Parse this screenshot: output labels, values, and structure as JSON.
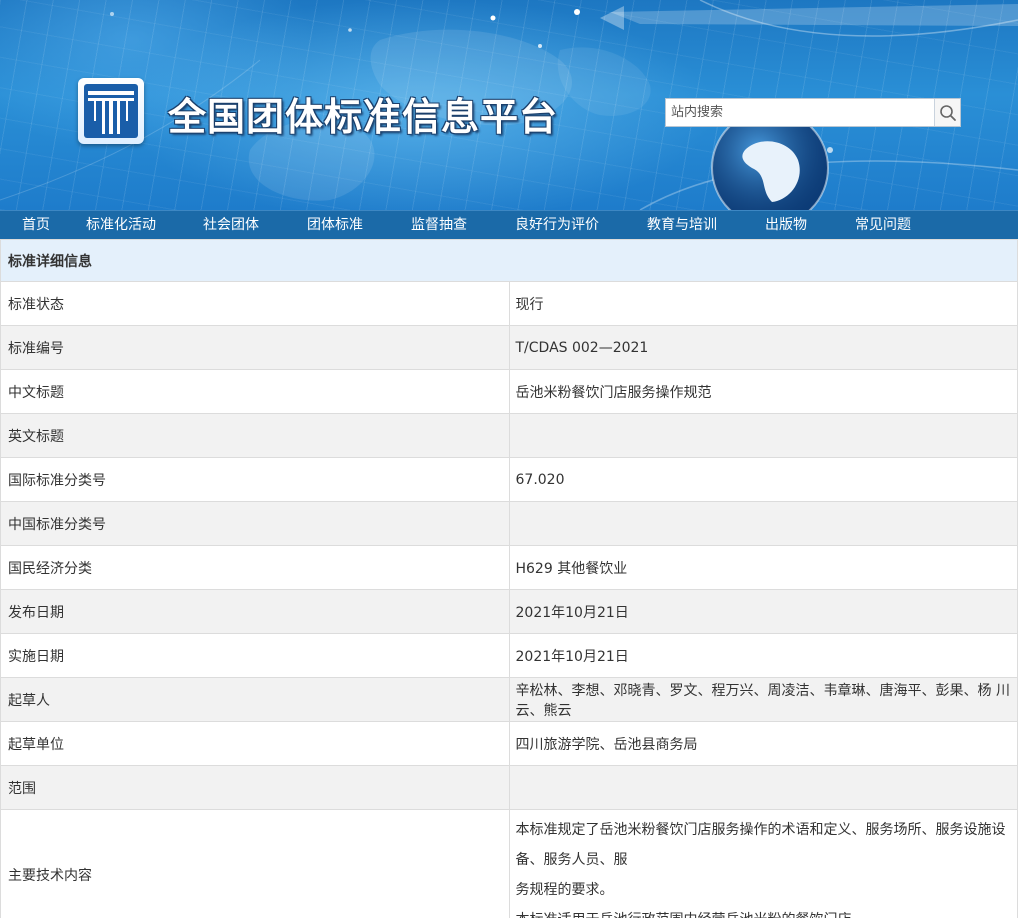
{
  "header": {
    "site_title": "全国团体标准信息平台",
    "search_placeholder": "站内搜索",
    "search_icon": "search-icon",
    "logo_icon": "standards-logo-icon"
  },
  "nav": {
    "items": [
      "首页",
      "标准化活动",
      "社会团体",
      "团体标准",
      "监督抽查",
      "良好行为评价",
      "教育与培训",
      "出版物",
      "常见问题"
    ]
  },
  "detail": {
    "heading": "标准详细信息",
    "rows": [
      {
        "label": "标准状态",
        "value": "现行"
      },
      {
        "label": "标准编号",
        "value": "T/CDAS 002—2021"
      },
      {
        "label": "中文标题",
        "value": "岳池米粉餐饮门店服务操作规范"
      },
      {
        "label": "英文标题",
        "value": ""
      },
      {
        "label": "国际标准分类号",
        "value": "67.020"
      },
      {
        "label": "中国标准分类号",
        "value": ""
      },
      {
        "label": "国民经济分类",
        "value": "H629 其他餐饮业"
      },
      {
        "label": "发布日期",
        "value": "2021年10月21日"
      },
      {
        "label": "实施日期",
        "value": "2021年10月21日"
      },
      {
        "label": "起草人",
        "value": "辛松林、李想、邓晓青、罗文、程万兴、周凌洁、韦章琳、唐海平、彭果、杨 川云、熊云"
      },
      {
        "label": "起草单位",
        "value": "四川旅游学院、岳池县商务局"
      },
      {
        "label": "范围",
        "value": ""
      }
    ],
    "main_content": {
      "label": "主要技术内容",
      "lines": [
        "本标准规定了岳池米粉餐饮门店服务操作的术语和定义、服务场所、服务设施设备、服务人员、服",
        "务规程的要求。",
        "本标准适用于岳池行政范围内经营岳池米粉的餐饮门店。"
      ]
    }
  },
  "colors": {
    "nav_bg": "#1b6aa8",
    "header_row_bg": "#e4f0fb",
    "alt_row_bg": "#f2f2f2",
    "border": "#dcdcdc"
  }
}
